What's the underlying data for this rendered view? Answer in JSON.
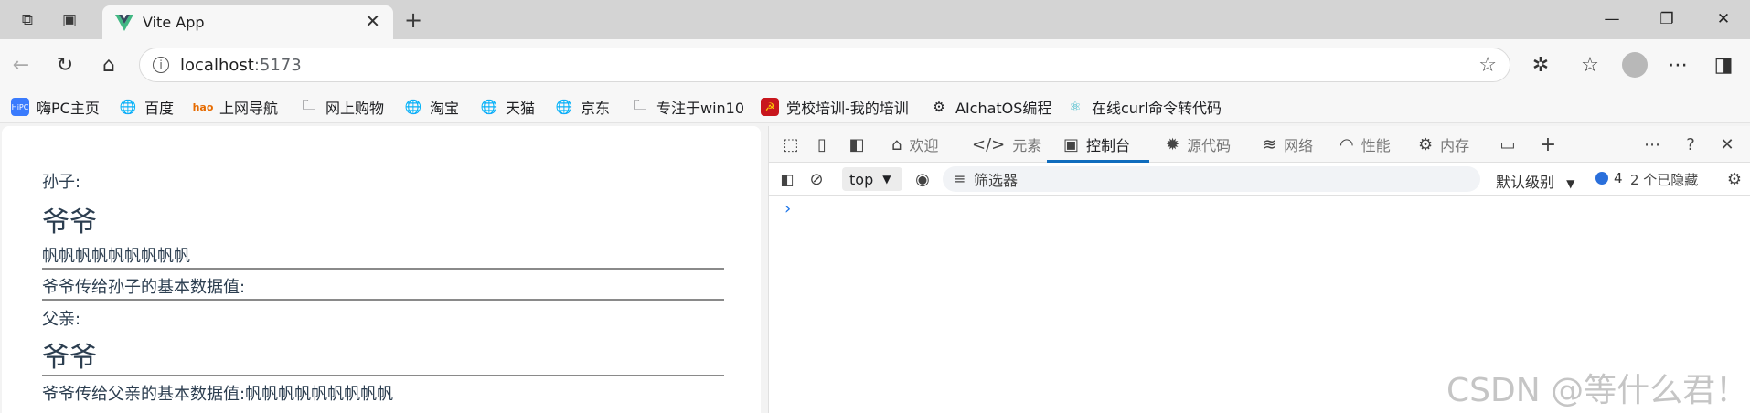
{
  "tab": {
    "title": "Vite App"
  },
  "address": {
    "host": "localhost",
    "port": ":5173"
  },
  "bookmarks": [
    {
      "label": "嗨PC主页",
      "icon": "hipc-icon"
    },
    {
      "label": "百度",
      "icon": "globe-icon"
    },
    {
      "label": "上网导航",
      "icon": "hao-icon"
    },
    {
      "label": "网上购物",
      "icon": "folder-icon"
    },
    {
      "label": "淘宝",
      "icon": "globe-icon"
    },
    {
      "label": "天猫",
      "icon": "globe-icon"
    },
    {
      "label": "京东",
      "icon": "globe-icon"
    },
    {
      "label": "专注于win10",
      "icon": "folder-icon"
    },
    {
      "label": "党校培训-我的培训",
      "icon": "party-icon"
    },
    {
      "label": "AIchatOS编程",
      "icon": "openai-icon"
    },
    {
      "label": "在线curl命令转代码",
      "icon": "react-icon"
    }
  ],
  "content": {
    "grandson_label": "孙子:",
    "grandpa_heading_1": "爷爷",
    "grandson_value": "帆帆帆帆帆帆帆帆帆",
    "grandson_desc": "爷爷传给孙子的基本数据值:",
    "father_label": "父亲:",
    "grandpa_heading_2": "爷爷",
    "father_desc": "爷爷传给父亲的基本数据值:",
    "father_value": "帆帆帆帆帆帆帆帆帆"
  },
  "devtools": {
    "tabs": [
      {
        "label": "欢迎",
        "icon": "home-icon"
      },
      {
        "label": "元素",
        "icon": "code-icon"
      },
      {
        "label": "控制台",
        "icon": "console-icon"
      },
      {
        "label": "源代码",
        "icon": "bug-icon"
      },
      {
        "label": "网络",
        "icon": "wifi-icon"
      },
      {
        "label": "性能",
        "icon": "gauge-icon"
      },
      {
        "label": "内存",
        "icon": "chip-icon"
      }
    ],
    "active_tab": "控制台",
    "context": "top",
    "filter_placeholder": "筛选器",
    "level": "默认级别",
    "issues_count": "4",
    "hidden": "2 个已隐藏",
    "prompt": "›"
  },
  "watermark": "CSDN @等什么君！",
  "colors": {
    "accent": "#0f6cbd",
    "vue_text": "#2c3e50",
    "vite_logo": "#41b883"
  }
}
